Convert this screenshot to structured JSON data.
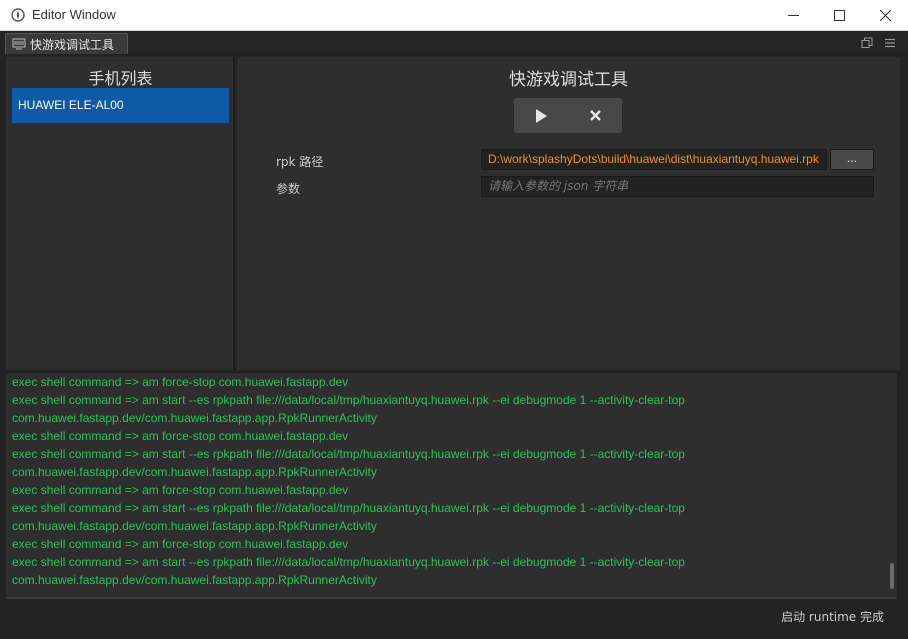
{
  "window": {
    "title": "Editor Window",
    "tab_label": "快游戏调试工具"
  },
  "left_panel": {
    "title": "手机列表",
    "devices": [
      "HUAWEI ELE-AL00"
    ]
  },
  "right_panel": {
    "title": "快游戏调试工具",
    "rpk_label": "rpk 路径",
    "rpk_path": "D:\\work\\splashyDots\\build\\huawei\\dist\\huaxiantuyq.huawei.rpk",
    "browse_label": "...",
    "params_label": "参数",
    "params_placeholder": "请输入参数的 json 字符串"
  },
  "log": {
    "lines": [
      "exec shell command => am force-stop com.huawei.fastapp.dev",
      "exec shell command => am start --es rpkpath file:///data/local/tmp/huaxiantuyq.huawei.rpk --ei debugmode 1 --activity-clear-top",
      "com.huawei.fastapp.dev/com.huawei.fastapp.app.RpkRunnerActivity",
      "exec shell command => am force-stop com.huawei.fastapp.dev",
      "exec shell command => am start --es rpkpath file:///data/local/tmp/huaxiantuyq.huawei.rpk --ei debugmode 1 --activity-clear-top",
      "com.huawei.fastapp.dev/com.huawei.fastapp.app.RpkRunnerActivity",
      "exec shell command => am force-stop com.huawei.fastapp.dev",
      "exec shell command => am start --es rpkpath file:///data/local/tmp/huaxiantuyq.huawei.rpk --ei debugmode 1 --activity-clear-top",
      "com.huawei.fastapp.dev/com.huawei.fastapp.app.RpkRunnerActivity",
      "exec shell command => am force-stop com.huawei.fastapp.dev",
      "exec shell command => am start --es rpkpath file:///data/local/tmp/huaxiantuyq.huawei.rpk --ei debugmode 1 --activity-clear-top",
      "com.huawei.fastapp.dev/com.huawei.fastapp.app.RpkRunnerActivity"
    ]
  },
  "status": {
    "text": "启动 runtime 完成"
  },
  "colors": {
    "log_text": "#26c45a",
    "selected_device": "#0e5aa7",
    "rpk_path_text": "#f0902a",
    "panel_bg": "#2e2e2e"
  },
  "icons": {
    "app": "cocos-logo-icon",
    "tab": "monitor-icon",
    "play": "play-icon",
    "stop": "x-icon",
    "restore": "restore-window-icon",
    "menu": "hamburger-menu-icon"
  }
}
